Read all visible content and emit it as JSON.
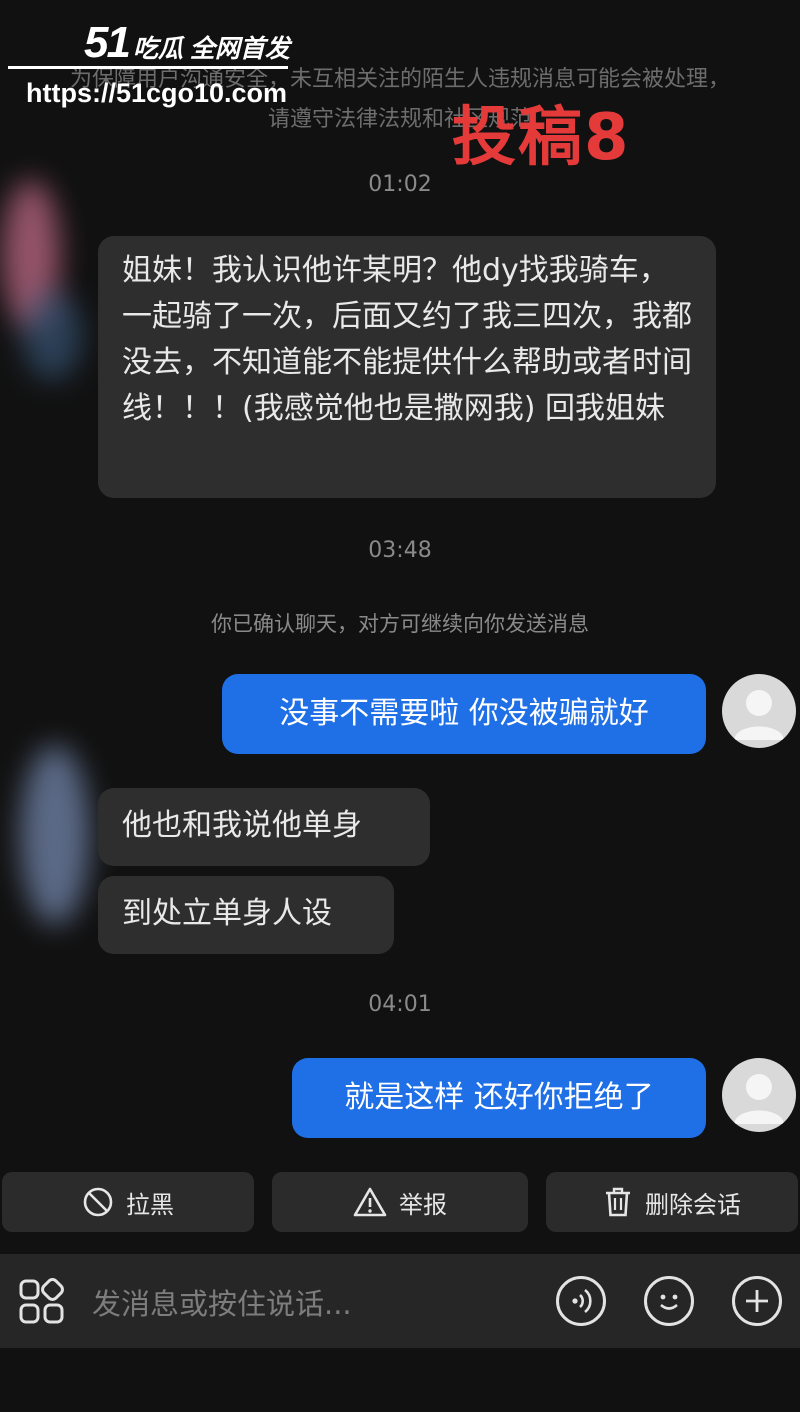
{
  "watermark": {
    "logo_number": "51",
    "logo_text": "吃瓜 全网首发",
    "url": "https://51cgo10.com",
    "submission": "投稿8"
  },
  "notice": {
    "text": "为保障用户沟通安全，未互相关注的陌生人违规消息可能会被处理，请遵守法律法规和社区规范"
  },
  "timestamps": [
    "01:02",
    "03:48",
    "04:01"
  ],
  "system_note": "你已确认聊天，对方可继续向你发送消息",
  "messages": [
    {
      "side": "in",
      "text": "姐妹！我认识他许某明？他dy找我骑车，一起骑了一次，后面又约了我三四次，我都没去，不知道能不能提供什么帮助或者时间线！！！(我感觉他也是撒网我) 回我姐妹"
    },
    {
      "side": "out",
      "text": "没事不需要啦 你没被骗就好"
    },
    {
      "side": "in",
      "text": "他也和我说他单身"
    },
    {
      "side": "in",
      "text": "到处立单身人设"
    },
    {
      "side": "out",
      "text": "就是这样 还好你拒绝了"
    }
  ],
  "actions": {
    "block": "拉黑",
    "report": "举报",
    "delete": "删除会话"
  },
  "composer": {
    "placeholder": "发消息或按住说话..."
  },
  "colors": {
    "background": "#111111",
    "bubble_incoming": "#2e2e2e",
    "bubble_outgoing": "#1f6fe6",
    "watermark_red": "#e53a3a"
  },
  "icons": [
    "apps-grid-icon",
    "voice-icon",
    "emoji-icon",
    "plus-icon",
    "block-icon",
    "warning-icon",
    "trash-icon",
    "avatar-icon"
  ]
}
